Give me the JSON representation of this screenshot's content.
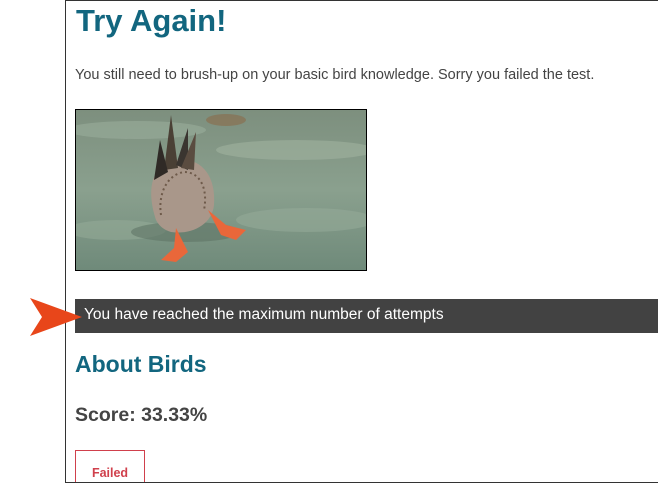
{
  "result": {
    "heading": "Try Again!",
    "message": "You still need to brush-up on your basic bird knowledge. Sorry you failed the test."
  },
  "image": {
    "icon": "duck-photo"
  },
  "notice": {
    "text": "You have reached the maximum number of attempts"
  },
  "about": {
    "title": "About Birds",
    "score": "Score: 33.33%",
    "status": "Failed"
  },
  "colors": {
    "heading": "#12667f",
    "notice_bg": "#424242",
    "failed": "#d0404c",
    "arrow": "#e8461a"
  }
}
